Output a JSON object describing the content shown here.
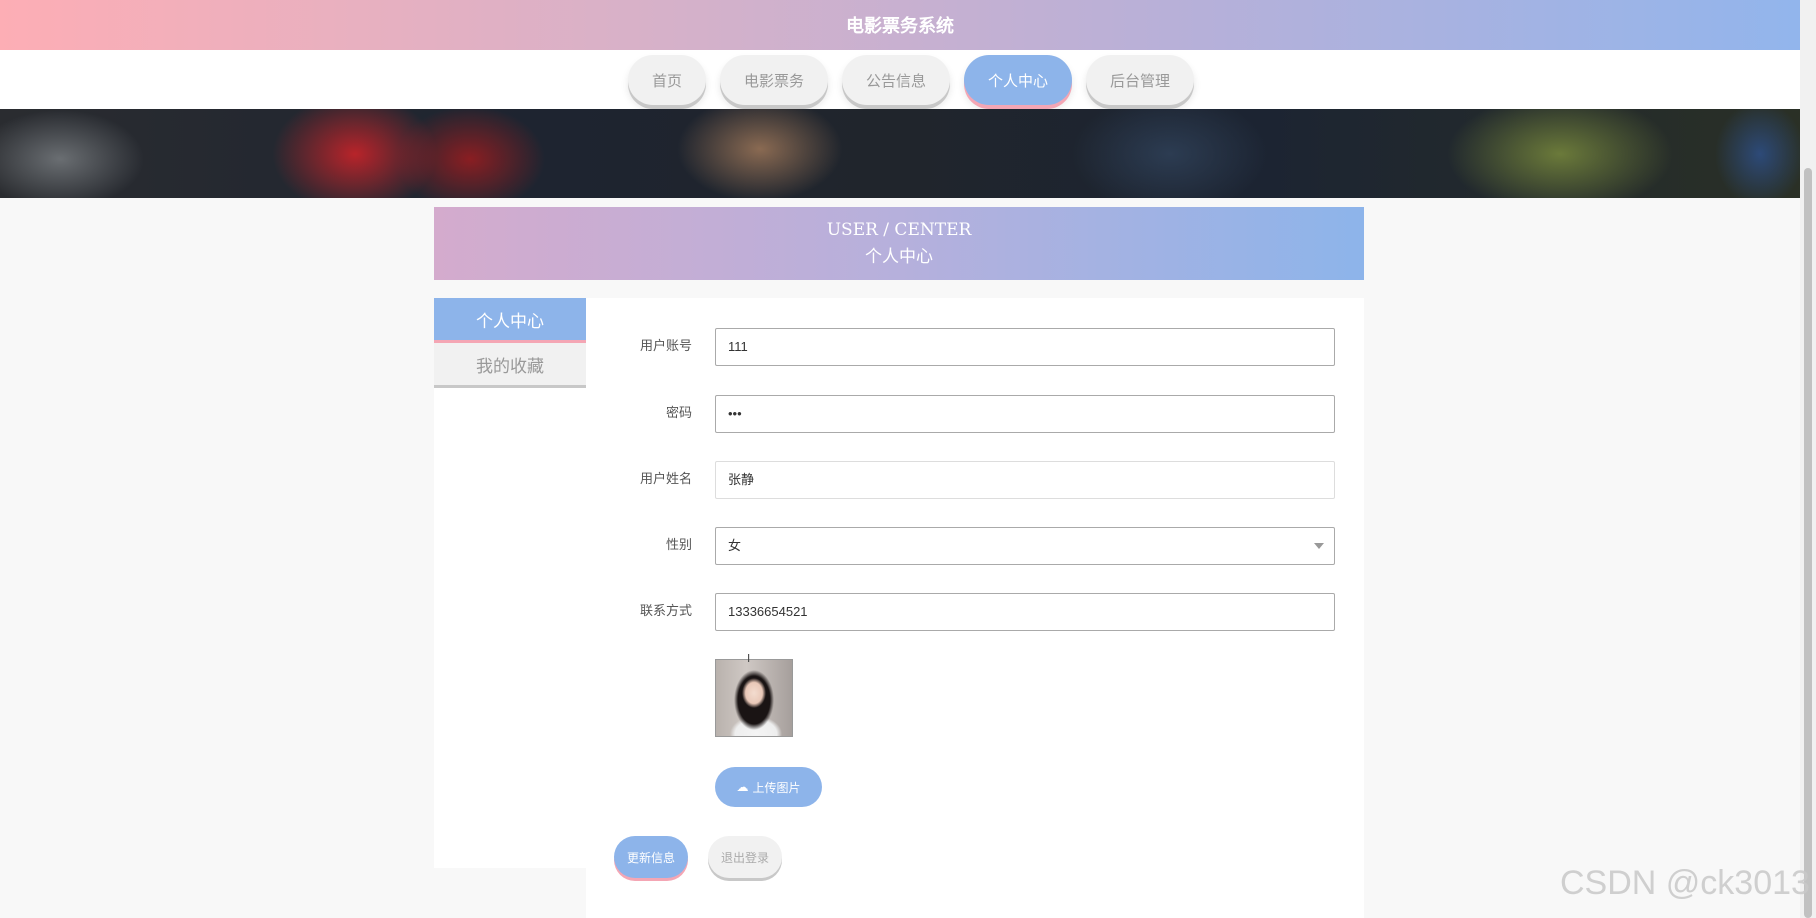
{
  "app_title": "电影票务系统",
  "nav": [
    {
      "label": "首页",
      "active": false
    },
    {
      "label": "电影票务",
      "active": false
    },
    {
      "label": "公告信息",
      "active": false
    },
    {
      "label": "个人中心",
      "active": true
    },
    {
      "label": "后台管理",
      "active": false
    }
  ],
  "section": {
    "en_title": "USER / CENTER",
    "zh_title": "个人中心"
  },
  "sidebar": {
    "items": [
      {
        "label": "个人中心",
        "active": true
      },
      {
        "label": "我的收藏",
        "active": false
      }
    ]
  },
  "form": {
    "account": {
      "label": "用户账号",
      "value": "111"
    },
    "password": {
      "label": "密码",
      "value": "•••"
    },
    "name": {
      "label": "用户姓名",
      "value": "张静"
    },
    "gender": {
      "label": "性别",
      "value": "女"
    },
    "phone": {
      "label": "联系方式",
      "value": "13336654521"
    },
    "upload_label": "上传图片"
  },
  "actions": {
    "update_label": "更新信息",
    "logout_label": "退出登录"
  },
  "watermark": "CSDN @ck3013",
  "colors": {
    "accent": "#8db4ea",
    "pink": "#f4a6b4"
  }
}
